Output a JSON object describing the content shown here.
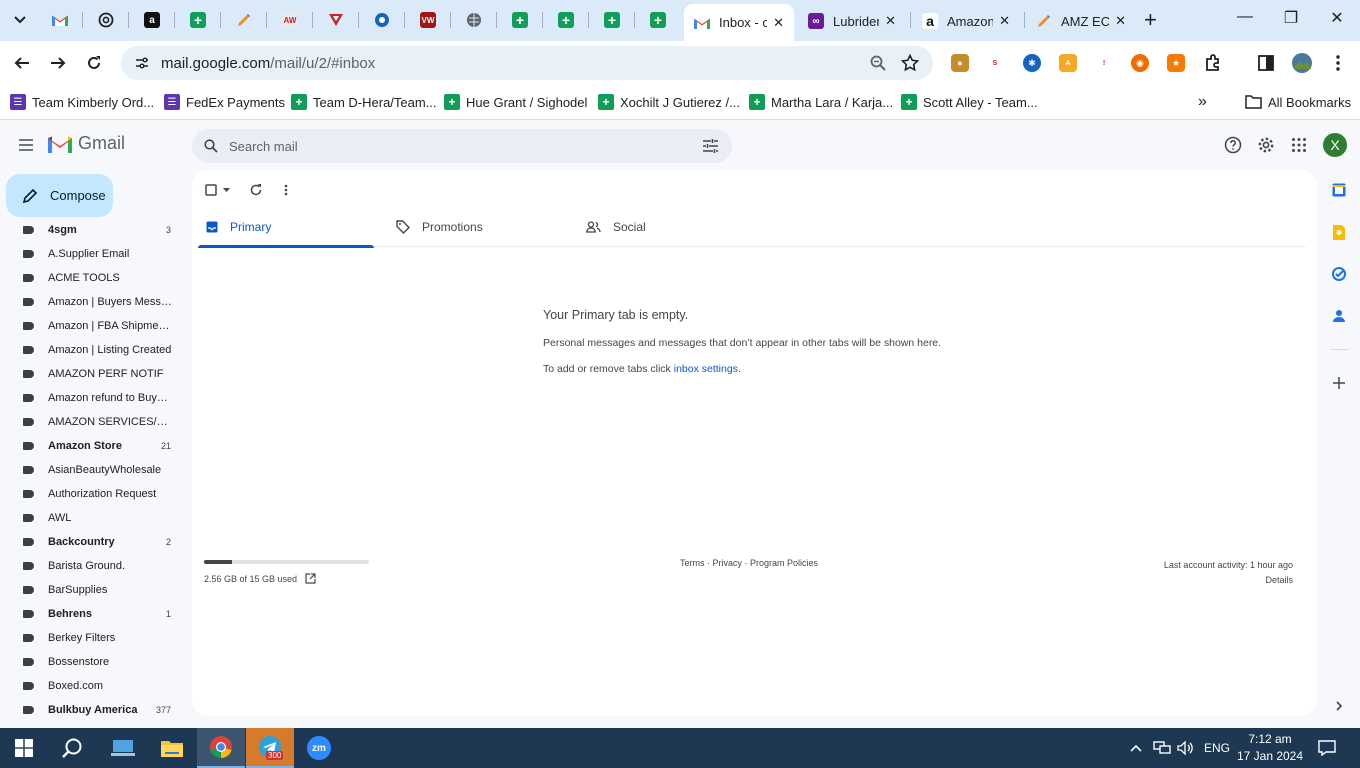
{
  "browser": {
    "tabs": [
      {
        "title": "Inbox - c",
        "active": true
      },
      {
        "title": "Lubrider"
      },
      {
        "title": "Amazon"
      },
      {
        "title": "AMZ EC"
      }
    ],
    "url_host": "mail.google.com",
    "url_path": "/mail/u/2/#inbox",
    "bookmarks": [
      "Team Kimberly Ord...",
      "FedEx Payments",
      "Team D-Hera/Team...",
      "Hue Grant / Sighodel",
      "Xochilt J Gutierez /...",
      "Martha Lara / Karja...",
      "Scott Alley - Team..."
    ],
    "all_bookmarks": "All Bookmarks"
  },
  "gmail": {
    "wordmark": "Gmail",
    "search_placeholder": "Search mail",
    "compose": "Compose",
    "avatar_initial": "X",
    "labels": [
      {
        "name": "4sgm",
        "count": "3",
        "bold": true
      },
      {
        "name": "A.Supplier Email",
        "count": ""
      },
      {
        "name": "ACME TOOLS",
        "count": ""
      },
      {
        "name": "Amazon | Buyers Messa...",
        "count": ""
      },
      {
        "name": "Amazon | FBA Shipments",
        "count": ""
      },
      {
        "name": "Amazon | Listing Created",
        "count": ""
      },
      {
        "name": "AMAZON PERF NOTIF",
        "count": ""
      },
      {
        "name": "Amazon refund to Buyers",
        "count": ""
      },
      {
        "name": "AMAZON SERVICES/PAY...",
        "count": ""
      },
      {
        "name": "Amazon Store",
        "count": "21",
        "bold": true
      },
      {
        "name": "AsianBeautyWholesale",
        "count": ""
      },
      {
        "name": "Authorization Request",
        "count": ""
      },
      {
        "name": "AWL",
        "count": ""
      },
      {
        "name": "Backcountry",
        "count": "2",
        "bold": true
      },
      {
        "name": "Barista Ground.",
        "count": ""
      },
      {
        "name": "BarSupplies",
        "count": ""
      },
      {
        "name": "Behrens",
        "count": "1",
        "bold": true
      },
      {
        "name": "Berkey Filters",
        "count": ""
      },
      {
        "name": "Bossenstore",
        "count": ""
      },
      {
        "name": "Boxed.com",
        "count": ""
      },
      {
        "name": "Bulkbuy America",
        "count": "377",
        "bold": true
      }
    ],
    "inbox_tabs": [
      {
        "label": "Primary",
        "icon": "inbox-icon",
        "active": true
      },
      {
        "label": "Promotions",
        "icon": "tag-icon"
      },
      {
        "label": "Social",
        "icon": "people-icon"
      }
    ],
    "empty": {
      "title": "Your Primary tab is empty.",
      "line1": "Personal messages and messages that don’t appear in other tabs will be shown here.",
      "line2_prefix": "To add or remove tabs click ",
      "line2_link": "inbox settings",
      "line2_suffix": "."
    },
    "storage": {
      "text": "2.56 GB of 15 GB used",
      "fraction": 0.17
    },
    "footer_links": "Terms · Privacy · Program Policies",
    "last_activity": "Last account activity: 1 hour ago",
    "details": "Details"
  },
  "taskbar": {
    "language": "ENG",
    "time": "7:12 am",
    "date": "17 Jan 2024",
    "telegram_badge": "300"
  }
}
